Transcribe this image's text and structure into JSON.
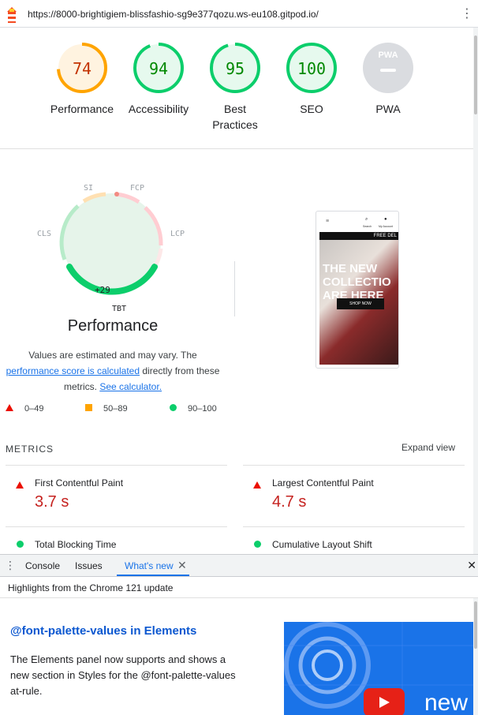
{
  "address_bar": {
    "url": "https://8000-brightigiem-blissfashio-sg9e377qozu.ws-eu108.gitpod.io/"
  },
  "categories": [
    {
      "label": "Performance",
      "score": "74",
      "fraction": 0.74,
      "color": "#ffa400",
      "bg": "#fff3e0",
      "text_color": "#c33300"
    },
    {
      "label": "Accessibility",
      "score": "94",
      "fraction": 0.94,
      "color": "#0cce6b",
      "bg": "#e6f9ee",
      "text_color": "#008800"
    },
    {
      "label_line1": "Best",
      "label_line2": "Practices",
      "score": "95",
      "fraction": 0.95,
      "color": "#0cce6b",
      "bg": "#e6f9ee",
      "text_color": "#008800"
    },
    {
      "label": "SEO",
      "score": "100",
      "fraction": 1.0,
      "color": "#0cce6b",
      "bg": "#e6f9ee",
      "text_color": "#008800"
    },
    {
      "label": "PWA",
      "badge": "PWA",
      "color": "#dadce0"
    }
  ],
  "performance": {
    "title": "Performance",
    "segment_labels": {
      "si": "SI",
      "fcp": "FCP",
      "lcp": "LCP",
      "cls": "CLS",
      "tbt": "TBT"
    },
    "delta": "+29",
    "desc_1": "Values are estimated and may vary. The",
    "desc_link": "performance score is calculated",
    "desc_2": "directly from these",
    "desc_3": "metrics.",
    "desc_link2": "See calculator."
  },
  "screenshot": {
    "promo": "FREE DEL",
    "hero_line1": "THE NEW",
    "hero_line2": "COLLECTIO",
    "hero_line3": "ARE HERE",
    "shop_button": "SHOP NOW",
    "search_label": "Search",
    "account_label": "My Account"
  },
  "legend": [
    {
      "range": "0–49",
      "shape": "triangle",
      "color": "#eb0f00"
    },
    {
      "range": "50–89",
      "shape": "square",
      "color": "#ffa400"
    },
    {
      "range": "90–100",
      "shape": "circle",
      "color": "#0cce6b"
    }
  ],
  "metrics": {
    "header": "METRICS",
    "expand": "Expand view",
    "items": [
      {
        "name": "First Contentful Paint",
        "value": "3.7 s",
        "status": "fail"
      },
      {
        "name": "Largest Contentful Paint",
        "value": "4.7 s",
        "status": "fail"
      },
      {
        "name": "Total Blocking Time",
        "status": "pass"
      },
      {
        "name": "Cumulative Layout Shift",
        "status": "pass"
      }
    ]
  },
  "devtools": {
    "tabs": [
      "Console",
      "Issues",
      "What's new"
    ],
    "active_tab": "What's new",
    "subheader": "Highlights from the Chrome 121 update",
    "article_title": "@font-palette-values in Elements",
    "article_body": "The Elements panel now supports and shows a new section in Styles for the @font-palette-values at-rule.",
    "video_text": "new"
  }
}
